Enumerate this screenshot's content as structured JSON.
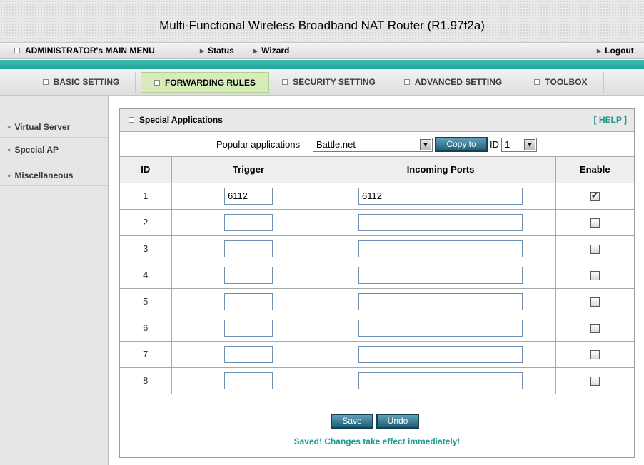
{
  "header": {
    "title": "Multi-Functional Wireless Broadband NAT Router (R1.97f2a)"
  },
  "menu": {
    "admin_label": "ADMINISTRATOR's MAIN MENU",
    "status_label": "Status",
    "wizard_label": "Wizard",
    "logout_label": "Logout"
  },
  "tabs": [
    {
      "label": "BASIC SETTING"
    },
    {
      "label": "FORWARDING RULES"
    },
    {
      "label": "SECURITY SETTING"
    },
    {
      "label": "ADVANCED SETTING"
    },
    {
      "label": "TOOLBOX"
    }
  ],
  "sidebar": {
    "items": [
      {
        "label": "Virtual Server"
      },
      {
        "label": "Special AP"
      },
      {
        "label": "Miscellaneous"
      }
    ]
  },
  "panel": {
    "title": "Special Applications",
    "help_label": "[ HELP ]",
    "popular_label": "Popular applications",
    "popular_selected": "Battle.net",
    "copy_button": "Copy to",
    "id_label": "ID",
    "id_selected": "1"
  },
  "table": {
    "headers": [
      "ID",
      "Trigger",
      "Incoming Ports",
      "Enable"
    ],
    "rows": [
      {
        "id": "1",
        "trigger": "6112",
        "incoming": "6112",
        "enabled": true
      },
      {
        "id": "2",
        "trigger": "",
        "incoming": "",
        "enabled": false
      },
      {
        "id": "3",
        "trigger": "",
        "incoming": "",
        "enabled": false
      },
      {
        "id": "4",
        "trigger": "",
        "incoming": "",
        "enabled": false
      },
      {
        "id": "5",
        "trigger": "",
        "incoming": "",
        "enabled": false
      },
      {
        "id": "6",
        "trigger": "",
        "incoming": "",
        "enabled": false
      },
      {
        "id": "7",
        "trigger": "",
        "incoming": "",
        "enabled": false
      },
      {
        "id": "8",
        "trigger": "",
        "incoming": "",
        "enabled": false
      }
    ]
  },
  "footer": {
    "save_button": "Save",
    "undo_button": "Undo",
    "message": "Saved! Changes take effect immediately!"
  },
  "colors": {
    "teal": "#23a59b",
    "active_tab": "#d6ecb9",
    "button": "#1f5f77",
    "help_text": "#1f9b92"
  }
}
